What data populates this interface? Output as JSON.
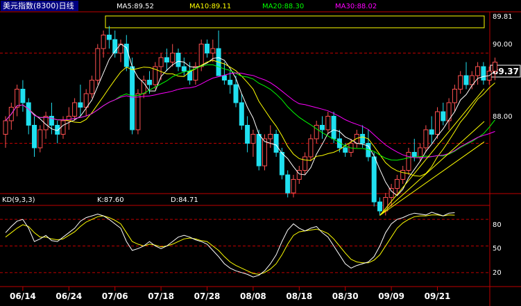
{
  "window": {
    "title": "美元指数(8300)日线",
    "colors": {
      "background": "#000000",
      "frame": "#c00000",
      "up": "#ff5050",
      "down": "#20e0f0",
      "ma5": "#ffffff",
      "ma10": "#ffff00",
      "ma20": "#00ff00",
      "ma30": "#ff00ff",
      "axis_text": "#ffffff",
      "highlight_box": "#ffff00"
    }
  },
  "chart_data": [
    {
      "type": "candlestick",
      "title": "美元指数(8300)日线",
      "indicators": [
        {
          "name": "MA5",
          "label": "MA5:89.52",
          "color": "#ffffff"
        },
        {
          "name": "MA10",
          "label": "MA10:89.11",
          "color": "#ffff00"
        },
        {
          "name": "MA20",
          "label": "MA20:88.30",
          "color": "#00ff00"
        },
        {
          "name": "MA30",
          "label": "MA30:88.02",
          "color": "#ff00ff"
        }
      ],
      "ylim": [
        86.9,
        90.9
      ],
      "yticks": [
        "90.00",
        "88.00"
      ],
      "y_tick_values": [
        90.0,
        88.0
      ],
      "high_label": "89.81",
      "high_value": 89.81,
      "current_label": "89.37",
      "current_value": 89.37,
      "x_tick_labels": [
        "06/14",
        "06/24",
        "07/06",
        "07/18",
        "07/28",
        "08/08",
        "08/18",
        "08/30",
        "09/09",
        "09/21"
      ],
      "x_tick_index": [
        3,
        11,
        19,
        27,
        35,
        43,
        51,
        59,
        67,
        75
      ],
      "ohlc": [
        [
          88.2,
          88.6,
          87.9,
          88.5
        ],
        [
          88.5,
          88.9,
          88.3,
          88.8
        ],
        [
          88.8,
          89.3,
          88.6,
          89.2
        ],
        [
          89.2,
          89.4,
          88.7,
          88.9
        ],
        [
          88.9,
          89.0,
          88.2,
          88.4
        ],
        [
          88.4,
          88.6,
          87.7,
          87.9
        ],
        [
          87.9,
          88.4,
          87.8,
          88.3
        ],
        [
          88.3,
          88.7,
          88.1,
          88.6
        ],
        [
          88.6,
          88.9,
          88.2,
          88.4
        ],
        [
          88.4,
          88.5,
          88.0,
          88.2
        ],
        [
          88.2,
          88.6,
          88.1,
          88.5
        ],
        [
          88.5,
          88.8,
          88.3,
          88.6
        ],
        [
          88.6,
          89.0,
          88.5,
          88.9
        ],
        [
          88.9,
          89.3,
          88.6,
          88.8
        ],
        [
          88.8,
          89.2,
          88.6,
          89.1
        ],
        [
          89.1,
          89.5,
          89.0,
          89.4
        ],
        [
          89.4,
          90.2,
          89.3,
          90.1
        ],
        [
          90.1,
          90.5,
          89.9,
          90.4
        ],
        [
          90.4,
          90.6,
          90.1,
          90.3
        ],
        [
          90.3,
          90.5,
          89.9,
          90.0
        ],
        [
          90.0,
          90.3,
          89.8,
          90.2
        ],
        [
          90.2,
          90.4,
          89.6,
          89.7
        ],
        [
          89.7,
          89.9,
          88.2,
          88.3
        ],
        [
          88.3,
          89.2,
          88.2,
          89.1
        ],
        [
          89.1,
          89.5,
          89.0,
          89.4
        ],
        [
          89.4,
          89.6,
          89.1,
          89.3
        ],
        [
          89.3,
          89.8,
          89.2,
          89.7
        ],
        [
          89.7,
          90.0,
          89.4,
          89.9
        ],
        [
          89.9,
          90.1,
          89.6,
          89.8
        ],
        [
          89.8,
          90.2,
          89.7,
          90.0
        ],
        [
          90.0,
          90.1,
          89.6,
          89.7
        ],
        [
          89.7,
          89.9,
          89.5,
          89.6
        ],
        [
          89.6,
          89.8,
          89.3,
          89.4
        ],
        [
          89.4,
          89.8,
          89.3,
          89.7
        ],
        [
          89.7,
          90.3,
          89.6,
          90.2
        ],
        [
          90.2,
          90.3,
          89.9,
          90.0
        ],
        [
          90.0,
          90.3,
          89.8,
          90.1
        ],
        [
          90.1,
          90.5,
          89.5,
          89.5
        ],
        [
          89.5,
          89.8,
          89.3,
          89.4
        ],
        [
          89.4,
          89.6,
          89.1,
          89.3
        ],
        [
          89.3,
          89.5,
          88.8,
          88.9
        ],
        [
          88.9,
          89.1,
          88.3,
          88.4
        ],
        [
          88.4,
          88.6,
          87.8,
          88.0
        ],
        [
          88.0,
          88.3,
          87.7,
          88.2
        ],
        [
          88.2,
          88.3,
          87.4,
          87.5
        ],
        [
          87.5,
          88.2,
          87.4,
          88.1
        ],
        [
          88.1,
          88.4,
          87.9,
          88.2
        ],
        [
          88.2,
          88.3,
          87.7,
          87.8
        ],
        [
          87.8,
          87.9,
          87.2,
          87.3
        ],
        [
          87.3,
          87.4,
          86.8,
          86.9
        ],
        [
          86.9,
          87.3,
          86.8,
          87.2
        ],
        [
          87.2,
          87.5,
          87.1,
          87.4
        ],
        [
          87.4,
          87.8,
          87.3,
          87.7
        ],
        [
          87.7,
          88.2,
          87.6,
          88.1
        ],
        [
          88.1,
          88.5,
          88.0,
          88.4
        ],
        [
          88.4,
          88.6,
          88.1,
          88.3
        ],
        [
          88.3,
          88.7,
          88.2,
          88.6
        ],
        [
          88.6,
          88.7,
          88.0,
          88.1
        ],
        [
          88.1,
          88.3,
          87.8,
          87.9
        ],
        [
          87.9,
          88.0,
          87.7,
          87.8
        ],
        [
          87.8,
          88.1,
          87.7,
          88.0
        ],
        [
          88.0,
          88.3,
          87.9,
          88.2
        ],
        [
          88.2,
          88.4,
          87.9,
          88.0
        ],
        [
          88.0,
          88.3,
          87.6,
          87.7
        ],
        [
          87.7,
          87.8,
          86.6,
          86.7
        ],
        [
          86.7,
          86.8,
          86.4,
          86.5
        ],
        [
          86.5,
          86.9,
          86.4,
          86.8
        ],
        [
          86.8,
          87.1,
          86.6,
          87.0
        ],
        [
          87.0,
          87.3,
          86.9,
          87.2
        ],
        [
          87.2,
          87.5,
          87.1,
          87.4
        ],
        [
          87.4,
          87.9,
          87.3,
          87.8
        ],
        [
          87.8,
          88.1,
          87.6,
          87.7
        ],
        [
          87.7,
          88.0,
          87.6,
          87.9
        ],
        [
          87.9,
          88.4,
          87.8,
          88.3
        ],
        [
          88.3,
          88.6,
          88.0,
          88.2
        ],
        [
          88.2,
          88.8,
          88.1,
          88.7
        ],
        [
          88.7,
          88.9,
          88.4,
          88.5
        ],
        [
          88.5,
          89.0,
          88.3,
          88.9
        ],
        [
          88.9,
          89.3,
          88.7,
          89.2
        ],
        [
          89.2,
          89.6,
          89.1,
          89.5
        ],
        [
          89.5,
          89.8,
          89.2,
          89.3
        ],
        [
          89.3,
          89.6,
          89.2,
          89.5
        ],
        [
          89.5,
          89.8,
          89.3,
          89.7
        ],
        [
          89.7,
          89.8,
          89.3,
          89.4
        ],
        [
          89.4,
          89.7,
          89.3,
          89.6
        ],
        [
          89.6,
          89.9,
          89.4,
          89.8
        ]
      ]
    },
    {
      "type": "line",
      "title": "KD(9,3,3)",
      "series": [
        {
          "name": "K",
          "label": "K:87.60",
          "color": "#ffffff"
        },
        {
          "name": "D",
          "label": "D:84.71",
          "color": "#ffff00"
        }
      ],
      "ylim": [
        5,
        95
      ],
      "yticks": [
        "80",
        "50",
        "20"
      ],
      "y_tick_values": [
        80,
        50,
        20
      ],
      "k": [
        65,
        72,
        78,
        80,
        70,
        55,
        58,
        62,
        56,
        55,
        60,
        65,
        70,
        78,
        82,
        84,
        86,
        84,
        80,
        75,
        70,
        55,
        45,
        47,
        50,
        55,
        50,
        47,
        50,
        55,
        60,
        62,
        60,
        57,
        55,
        52,
        45,
        38,
        30,
        25,
        22,
        20,
        18,
        15,
        17,
        22,
        30,
        40,
        55,
        68,
        75,
        70,
        67,
        70,
        72,
        65,
        60,
        50,
        40,
        30,
        25,
        28,
        30,
        32,
        38,
        50,
        65,
        75,
        80,
        82,
        85,
        87,
        86,
        85,
        88,
        86,
        84,
        87,
        87.6
      ],
      "d": [
        60,
        65,
        70,
        74,
        72,
        65,
        60,
        60,
        58,
        57,
        58,
        62,
        66,
        72,
        77,
        80,
        83,
        84,
        82,
        79,
        75,
        65,
        55,
        52,
        50,
        52,
        51,
        49,
        50,
        52,
        55,
        58,
        59,
        58,
        56,
        55,
        50,
        45,
        38,
        32,
        28,
        25,
        22,
        19,
        18,
        20,
        24,
        30,
        40,
        52,
        62,
        66,
        67,
        68,
        69,
        67,
        64,
        58,
        50,
        42,
        35,
        32,
        31,
        31,
        34,
        40,
        50,
        60,
        70,
        76,
        80,
        83,
        84,
        84,
        85,
        85,
        84,
        85,
        84.71
      ]
    }
  ]
}
